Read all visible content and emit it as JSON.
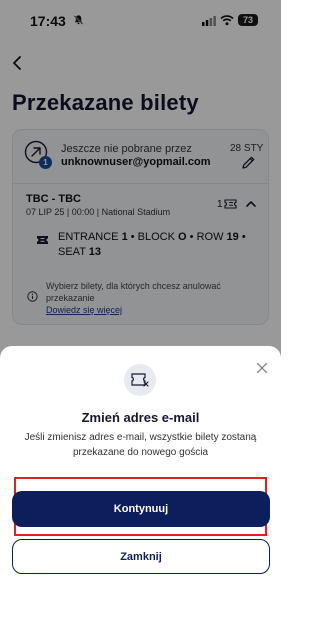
{
  "status_bar": {
    "time": "17:43",
    "battery": "73"
  },
  "header": {
    "title": "Przekazane bilety"
  },
  "transfer": {
    "pending_label": "Jeszcze nie pobrane przez",
    "recipient_email": "unknownuser@yopmail.com",
    "date": "28 STY",
    "badge_count": "1"
  },
  "event": {
    "name": "TBC - TBC",
    "details": "07 LIP 25 | 00:00 | National Stadium",
    "ticket_count": "1"
  },
  "seat": {
    "entrance_label": "ENTRANCE",
    "entrance_value": "1",
    "block_label": "BLOCK",
    "block_value": "O",
    "row_label": "ROW",
    "row_value": "19",
    "seat_label": "SEAT",
    "seat_value": "13"
  },
  "info": {
    "text": "Wybierz bilety, dla których chcesz anulować przekazanie",
    "link": "Dowiedz się więcej"
  },
  "dialog": {
    "title": "Zmień adres e-mail",
    "message": "Jeśli zmienisz adres e-mail, wszystkie bilety zostaną przekazane do nowego gościa",
    "continue_label": "Kontynuuj",
    "close_label": "Zamknij"
  },
  "icons": {
    "bell": "bell-slash-icon",
    "signal": "signal-icon",
    "wifi": "wifi-icon",
    "back": "chevron-left-icon",
    "transfer": "transfer-arrow-icon",
    "edit": "pencil-icon",
    "ticket": "ticket-icon",
    "chevron": "chevron-up-icon",
    "info": "info-icon",
    "close": "close-icon",
    "ticket_cancel": "ticket-cancel-icon"
  },
  "colors": {
    "primary": "#0c1f5c",
    "highlight": "#e02020",
    "badge": "#1a4a9e"
  }
}
